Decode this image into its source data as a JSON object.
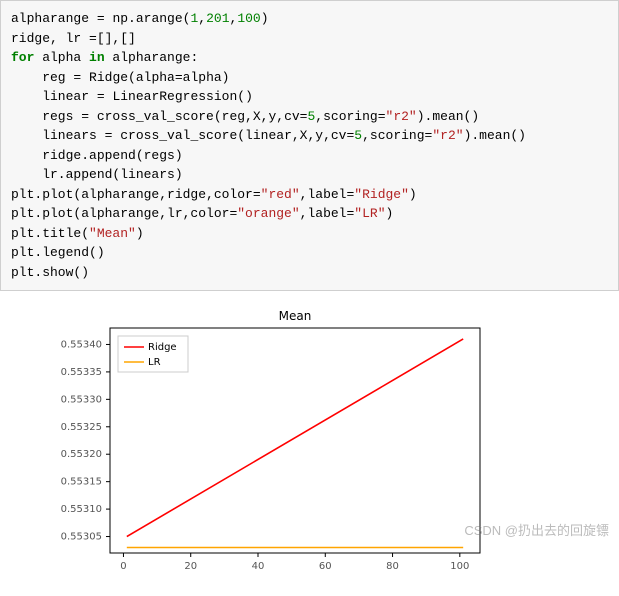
{
  "code": {
    "lines": [
      "alpharange = np.arange(1,201,100)",
      "ridge, lr =[],[]",
      "for alpha in alpharange:",
      "    reg = Ridge(alpha=alpha)",
      "    linear = LinearRegression()",
      "    regs = cross_val_score(reg,X,y,cv=5,scoring=\"r2\").mean()",
      "    linears = cross_val_score(linear,X,y,cv=5,scoring=\"r2\").mean()",
      "    ridge.append(regs)",
      "    lr.append(linears)",
      "plt.plot(alpharange,ridge,color=\"red\",label=\"Ridge\")",
      "plt.plot(alpharange,lr,color=\"orange\",label=\"LR\")",
      "plt.title(\"Mean\")",
      "plt.legend()",
      "plt.show()"
    ]
  },
  "chart_data": {
    "type": "line",
    "title": "Mean",
    "xlabel": "",
    "ylabel": "",
    "xlim": [
      -4,
      106
    ],
    "ylim": [
      0.55302,
      0.55343
    ],
    "xticks": [
      0,
      20,
      40,
      60,
      80,
      100
    ],
    "yticks": [
      0.55305,
      0.5531,
      0.55315,
      0.5532,
      0.55325,
      0.5533,
      0.55335,
      0.5534
    ],
    "x": [
      1,
      101
    ],
    "series": [
      {
        "name": "Ridge",
        "color": "#ff0000",
        "values": [
          0.55305,
          0.55341
        ]
      },
      {
        "name": "LR",
        "color": "#ffa500",
        "values": [
          0.55303,
          0.55303
        ]
      }
    ],
    "legend_position": "upper-left"
  },
  "watermark": "CSDN @扔出去的回旋镖"
}
